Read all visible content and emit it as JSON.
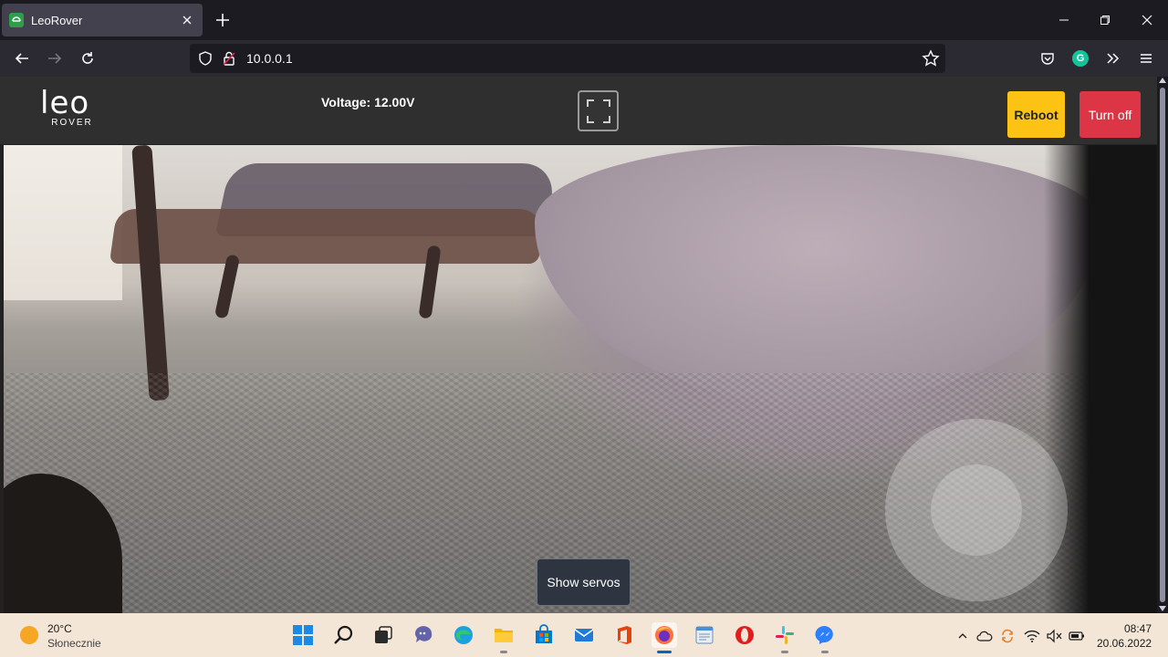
{
  "browser": {
    "tab_title": "LeoRover",
    "url": "10.0.0.1",
    "grammarly_letter": "G"
  },
  "app": {
    "logo_main": "leo",
    "logo_sub": "ROVER",
    "voltage_text": "Voltage: 12.00V",
    "reboot_label": "Reboot",
    "turnoff_label": "Turn off",
    "servos_label": "Show servos",
    "colors": {
      "reboot": "#fcc314",
      "turnoff": "#dc3545",
      "header": "#2f2f2f"
    }
  },
  "taskbar": {
    "weather_temp": "20°C",
    "weather_desc": "Słonecznie",
    "time": "08:47",
    "date": "20.06.2022",
    "apps": [
      "windows-start",
      "search",
      "task-view",
      "teams-chat",
      "edge",
      "file-explorer",
      "store",
      "mail",
      "office",
      "firefox",
      "notepad",
      "opera",
      "slack",
      "messenger"
    ]
  }
}
